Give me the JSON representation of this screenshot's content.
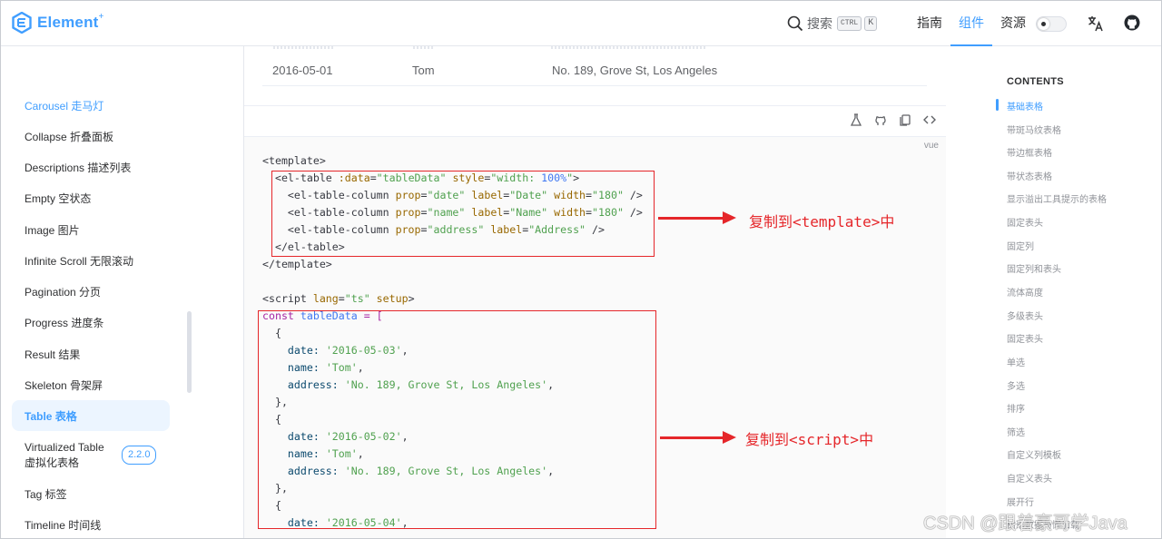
{
  "header": {
    "logo_text": "Element",
    "logo_sup": "+",
    "search_label": "搜索",
    "kbd_ctrl": "CTRL",
    "kbd_k": "K",
    "nav": [
      "指南",
      "组件",
      "资源"
    ]
  },
  "sidebar": {
    "items": [
      {
        "label": "Carousel 走马灯",
        "state": "link"
      },
      {
        "label": "Collapse 折叠面板"
      },
      {
        "label": "Descriptions 描述列表"
      },
      {
        "label": "Empty 空状态"
      },
      {
        "label": "Image 图片"
      },
      {
        "label": "Infinite Scroll 无限滚动"
      },
      {
        "label": "Pagination 分页"
      },
      {
        "label": "Progress 进度条"
      },
      {
        "label": "Result 结果"
      },
      {
        "label": "Skeleton 骨架屏"
      },
      {
        "label": "Table 表格",
        "state": "active"
      },
      {
        "label_line1": "Virtualized Table",
        "label_line2": "虚拟化表格",
        "badge": "2.2.0"
      },
      {
        "label": "Tag 标签"
      },
      {
        "label": "Timeline 时间线"
      }
    ]
  },
  "table_row": {
    "date": "2016-05-01",
    "name": "Tom",
    "address": "No. 189, Grove St, Los Angeles"
  },
  "code": {
    "lang": "vue",
    "template_open": "<template>",
    "el_table_open": "<el-table ",
    "data_attr": ":data",
    "data_val": "\"tableData\"",
    "style_attr": "style",
    "style_val_a": "\"width: ",
    "style_val_num": "100%",
    "style_val_b": "\"",
    "el_table_open_end": ">",
    "col_tag": "<el-table-column ",
    "prop": "prop",
    "label": "label",
    "width": "width",
    "eq": "=",
    "col_close": " />",
    "col1_prop": "\"date\"",
    "col1_label": "\"Date\"",
    "col1_width": "\"180\"",
    "col2_prop": "\"name\"",
    "col2_label": "\"Name\"",
    "col2_width": "\"180\"",
    "col3_prop": "\"address\"",
    "col3_label": "\"Address\"",
    "el_table_close": "</el-table>",
    "template_close": "</template>",
    "script_open": "<script ",
    "lang_attr": "lang",
    "lang_val": "\"ts\"",
    "setup": " setup",
    "script_open_end": ">",
    "const_kw": "const",
    "table_data": " tableData",
    "assign": " = [",
    "brace_open": "  {",
    "brace_close": "  },",
    "date_key": "    date: ",
    "name_key": "    name: ",
    "address_key": "    address: ",
    "date1": "'2016-05-03'",
    "date2": "'2016-05-02'",
    "date3": "'2016-05-04'",
    "name_val": "'Tom'",
    "address_val": "'No. 189, Grove St, Los Angeles'",
    "comma": ","
  },
  "annotations": {
    "template_note": "复制到<template>中",
    "script_note": "复制到<script>中"
  },
  "toc": {
    "title": "CONTENTS",
    "items": [
      "基础表格",
      "带斑马纹表格",
      "带边框表格",
      "带状态表格",
      "显示溢出工具提示的表格",
      "固定表头",
      "固定列",
      "固定列和表头",
      "流体高度",
      "多级表头",
      "固定表头",
      "单选",
      "多选",
      "排序",
      "筛选",
      "自定义列模板",
      "自定义表头",
      "展开行",
      "树形数据与懒加载"
    ]
  },
  "watermark": "CSDN @跟着豪哥学Java",
  "colors": {
    "accent": "#409eff",
    "annotation": "#e5262a"
  }
}
